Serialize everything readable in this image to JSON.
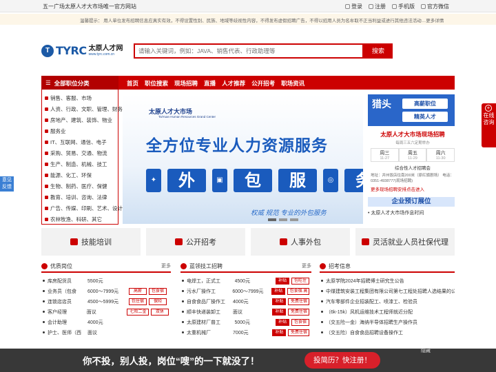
{
  "topbar": {
    "slogan": "五一广场太原人才大市场唯一官方网站",
    "links": [
      "登录",
      "注册",
      "手机版",
      "官方微信"
    ]
  },
  "notice": "温馨提示： 用人单位发布招聘信息应真实有效，不得设置性别、民族、地域等歧视性内容，不得发布虚假招聘广告，不得以招用人员为名牟取不正当利益或进行其他违法活动…更多详情",
  "logo": {
    "mark": "T",
    "brand": "TYRC",
    "cn": "太原人才网",
    "url": "www.tyrc.com.cn"
  },
  "search": {
    "placeholder": "请输入关键词，例如：JAVA、销售代表、行政助理等",
    "button": "搜索"
  },
  "nav": {
    "category_label": "全部职位分类",
    "items": [
      "首页",
      "职位搜索",
      "现场招聘",
      "直播",
      "人才推荐",
      "公开招考",
      "职场资讯"
    ]
  },
  "categories": [
    "销售、客服、市场",
    "人资、行政、文职、管理、财务",
    "房地产、建筑、装饰、物业",
    "服务业",
    "IT、互联网、通信、电子",
    "采购、贸易、交通、物流",
    "生产、制造、机械、技工",
    "能源、化工、环保",
    "生物、制药、医疗、保健",
    "教育、培训、咨询、法律",
    "广告、传媒、印刷、艺术、设计",
    "农林牧渔、科研、其它"
  ],
  "banner": {
    "logo": "太原人才大市场",
    "logo_sub": "TaiYuan Human Resources Grand Center",
    "headline": "全方位专业人力资源服务",
    "tiles": [
      "外",
      "包",
      "服",
      "务"
    ],
    "tagline": "权威 规范 专业的外包服务"
  },
  "right_ad": {
    "big": "猎头",
    "line1": "高薪职位",
    "line2": "精英人才"
  },
  "fair": {
    "title": "太原人才大市场现场招聘",
    "sub": "每周三五六定期举办",
    "days": [
      {
        "name": "周三",
        "date": "11-27"
      },
      {
        "name": "周五",
        "date": "11-29"
      },
      {
        "name": "周六",
        "date": "11-30"
      }
    ],
    "venue": "综合性人才招聘会",
    "address": "地址：并州饭店往南200米（原红旗剧场） 电话：0351-4938777(现场招聘)",
    "more": "更多现场招聘安排点击进入"
  },
  "reserve": {
    "title": "企业预订展位",
    "item": "太原人才大市场作息时间"
  },
  "services": [
    "技能培训",
    "公开招考",
    "人事外包",
    "灵活就业人员社保代理"
  ],
  "col1": {
    "title": "优质岗位",
    "more": "更多",
    "rows": [
      {
        "job": "库房配货员",
        "salary": "5500元",
        "tags": []
      },
      {
        "job": "业务员（包食",
        "salary": "6000～7999元",
        "tags": [
          "高薪",
          "包食宿"
        ]
      },
      {
        "job": "连锁店店员",
        "salary": "4500～5999元",
        "tags": [
          "包住宿",
          "保险"
        ]
      },
      {
        "job": "客户经理",
        "salary": "面议",
        "tags": [
          "七险二金",
          "双休"
        ]
      },
      {
        "job": "会计助理",
        "salary": "4000元",
        "tags": []
      },
      {
        "job": "护士、医师（西",
        "salary": "面议",
        "tags": []
      }
    ]
  },
  "col2": {
    "title": "蓝领技工招聘",
    "more": "更多",
    "rows": [
      {
        "job": "电焊工，正式工",
        "salary": "4500元",
        "tags": [
          "补贴",
          "包吃住"
        ]
      },
      {
        "job": "污水厂操作工",
        "salary": "6000～7999元",
        "tags": [
          "补贴",
          "包食宿.高"
        ]
      },
      {
        "job": "自食食品厂操作工",
        "salary": "4000元",
        "tags": [
          "补贴",
          "免费住宿"
        ]
      },
      {
        "job": "顺丰快递装卸工",
        "salary": "面议",
        "tags": [
          "补贴",
          "免费住宿"
        ]
      },
      {
        "job": "太原建材厂普工",
        "salary": "5000元",
        "tags": [
          "补贴",
          "包食宿"
        ]
      },
      {
        "job": "太重机械厂",
        "salary": "7000元",
        "tags": [
          "补贴",
          "免费住宿"
        ]
      }
    ]
  },
  "col3": {
    "title": "招考信息",
    "rows": [
      "太原学院2024年招聘博士研究生公告",
      "中煤建筑安装工程集团有限公司第七工程处招聘人选结果的公",
      "汽车零部件企业招装配工、喷漆工、检验员",
      "（6k-15k）风机运维技术工程师就近分配",
      "（交五险一金）海纳半导体招聘生产操作员",
      "（交五险）自食食品招聘设备操作工"
    ]
  },
  "footer_ad": {
    "message": "你不投，别人投，岗位“嗖”的一下就没了！",
    "cta": "投简历？快注册！",
    "hide": "隐藏"
  },
  "float_right": "在线咨询",
  "float_left": "意见反馈"
}
